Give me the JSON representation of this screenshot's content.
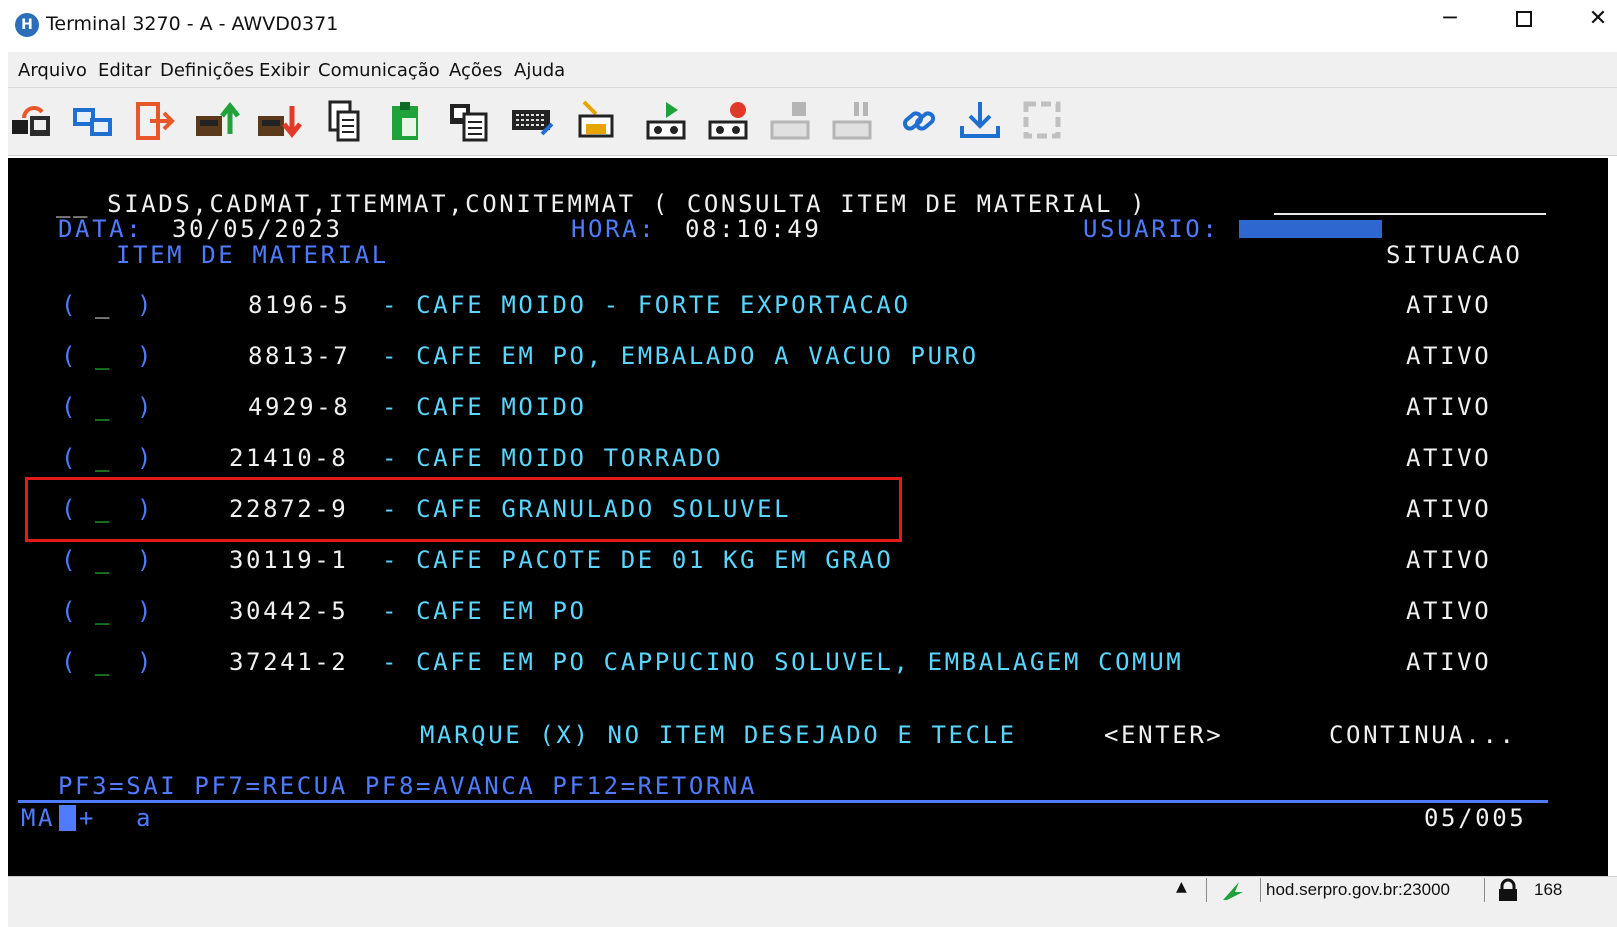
{
  "window": {
    "title": "Terminal 3270 - A - AWVD0371",
    "app_icon": "H",
    "min_glyph": "─",
    "close_glyph": "✕"
  },
  "menu": [
    {
      "label": "Arquivo"
    },
    {
      "label": "Editar"
    },
    {
      "label": "Definições"
    },
    {
      "label": "Exibir"
    },
    {
      "label": "Comunicação"
    },
    {
      "label": "Ações"
    },
    {
      "label": "Ajuda"
    }
  ],
  "toolbar": {
    "icons": [
      "disconnect-icon",
      "new-session-icon",
      "exit-icon",
      "send-file-icon",
      "receive-file-icon",
      "copy-icon",
      "paste-icon",
      "copy-append-icon",
      "keyboard-icon",
      "print-icon",
      "play-macro-icon",
      "record-macro-icon",
      "stop-macro-icon",
      "pause-macro-icon",
      "link-icon",
      "download-icon",
      "refresh-icon"
    ]
  },
  "terminal": {
    "header": "__ SIADS,CADMAT,ITEMMAT,CONITEMMAT ( CONSULTA ITEM DE MATERIAL )",
    "date_label": "DATA:",
    "date_value": "30/05/2023",
    "time_label": "HORA:",
    "time_value": "08:10:49",
    "user_label": "USUARIO:",
    "col_item": "ITEM DE MATERIAL",
    "col_status": "SITUACAO",
    "row_open": "(",
    "row_close": ")",
    "row_field": "_",
    "rows": [
      {
        "code": "8196-5",
        "desc": "- CAFE MOIDO - FORTE EXPORTACAO",
        "status": "ATIVO"
      },
      {
        "code": "8813-7",
        "desc": "- CAFE EM PO, EMBALADO A VACUO PURO",
        "status": "ATIVO"
      },
      {
        "code": "4929-8",
        "desc": "- CAFE MOIDO",
        "status": "ATIVO"
      },
      {
        "code": "21410-8",
        "desc": "- CAFE MOIDO TORRADO",
        "status": "ATIVO"
      },
      {
        "code": "22872-9",
        "desc": "- CAFE GRANULADO SOLUVEL",
        "status": "ATIVO"
      },
      {
        "code": "30119-1",
        "desc": "- CAFE PACOTE DE 01 KG EM GRAO",
        "status": "ATIVO"
      },
      {
        "code": "30442-5",
        "desc": "- CAFE EM PO",
        "status": "ATIVO"
      },
      {
        "code": "37241-2",
        "desc": "- CAFE EM PO CAPPUCINO SOLUVEL, EMBALAGEM COMUM",
        "status": "ATIVO"
      }
    ],
    "instruction_prefix": "MARQUE (X) NO ITEM DESEJADO E TECLE",
    "instruction_key": "<ENTER>",
    "continua": "CONTINUA...",
    "pf_keys": "PF3=SAI PF7=RECUA PF8=AVANCA PF12=RETORNA",
    "oia_left": "MA",
    "oia_plus": "+",
    "oia_a": "a",
    "page": "05/005"
  },
  "statusbar": {
    "arrow": "▲",
    "host": "hod.serpro.gov.br:23000",
    "number": "168"
  },
  "colors": {
    "terminal_bg": "#000000",
    "field_blue": "#4f7bff",
    "protected_cyan": "#5ad7ff",
    "input_green": "#2ee83a",
    "highlight_red": "#e11b1b"
  }
}
